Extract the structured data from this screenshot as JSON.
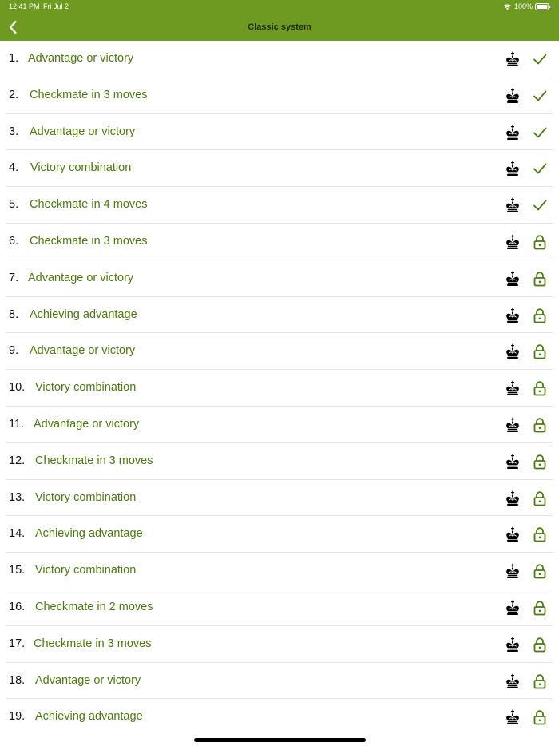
{
  "status_bar": {
    "time": "12:41 PM",
    "date": "Fri Jul 2",
    "battery": "100%"
  },
  "nav": {
    "title": "Classic system",
    "back_icon": "chevron-left-icon"
  },
  "colors": {
    "header_bg": "#6f9a22",
    "accent": "#4b7a0c"
  },
  "puzzles": [
    {
      "number": "1.",
      "title": "Advantage or victory",
      "status": "solved"
    },
    {
      "number": "2.",
      "title": "Checkmate in 3 moves",
      "status": "solved"
    },
    {
      "number": "3.",
      "title": "Advantage or victory",
      "status": "solved"
    },
    {
      "number": "4.",
      "title": "Victory combination",
      "status": "solved"
    },
    {
      "number": "5.",
      "title": "Checkmate in 4 moves",
      "status": "solved"
    },
    {
      "number": "6.",
      "title": "Checkmate in 3 moves",
      "status": "locked"
    },
    {
      "number": "7.",
      "title": "Advantage or victory",
      "status": "locked"
    },
    {
      "number": "8.",
      "title": "Achieving advantage",
      "status": "locked"
    },
    {
      "number": "9.",
      "title": "Advantage or victory",
      "status": "locked"
    },
    {
      "number": "10.",
      "title": "Victory combination",
      "status": "locked"
    },
    {
      "number": "11.",
      "title": "Advantage or victory",
      "status": "locked"
    },
    {
      "number": "12.",
      "title": "Checkmate in 3 moves",
      "status": "locked"
    },
    {
      "number": "13.",
      "title": "Victory combination",
      "status": "locked"
    },
    {
      "number": "14.",
      "title": "Achieving advantage",
      "status": "locked"
    },
    {
      "number": "15.",
      "title": "Victory combination",
      "status": "locked"
    },
    {
      "number": "16.",
      "title": "Checkmate in 2 moves",
      "status": "locked"
    },
    {
      "number": "17.",
      "title": "Checkmate in 3 moves",
      "status": "locked"
    },
    {
      "number": "18.",
      "title": "Advantage or victory",
      "status": "locked"
    },
    {
      "number": "19.",
      "title": "Achieving advantage",
      "status": "locked"
    }
  ]
}
